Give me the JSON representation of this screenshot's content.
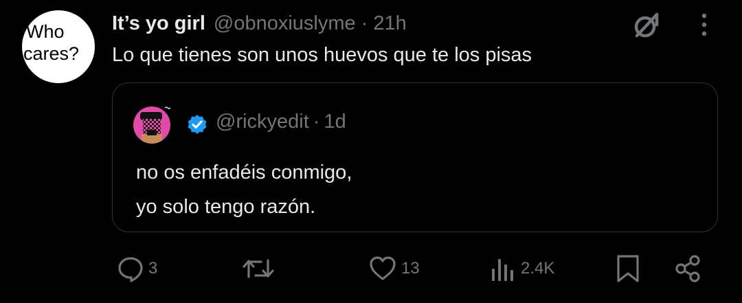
{
  "tweet": {
    "avatar_text_line1": "Who",
    "avatar_text_line2": "cares?",
    "display_name": "It’s yo girl",
    "handle": "@obnoxiuslyme",
    "separator": "·",
    "time": "21h",
    "text": "Lo que tienes son unos huevos que te los pisas"
  },
  "quote": {
    "handle": "@rickyedit",
    "separator": "·",
    "time": "1d",
    "text_line1": "no os enfadéis conmigo,",
    "text_line2": "yo solo tengo razón.",
    "verified_color": "#1d9bf0"
  },
  "actions": {
    "replies": "3",
    "reposts": "",
    "likes": "13",
    "views": "2.4K"
  },
  "colors": {
    "background": "#000000",
    "text": "#e7e9ea",
    "muted": "#71767b",
    "border": "#2f3336",
    "avatar_pink": "#e24aa8"
  },
  "icons": [
    "grok-icon",
    "more-icon",
    "verified-icon",
    "reply-icon",
    "repost-icon",
    "like-icon",
    "views-icon",
    "bookmark-icon",
    "share-icon"
  ]
}
